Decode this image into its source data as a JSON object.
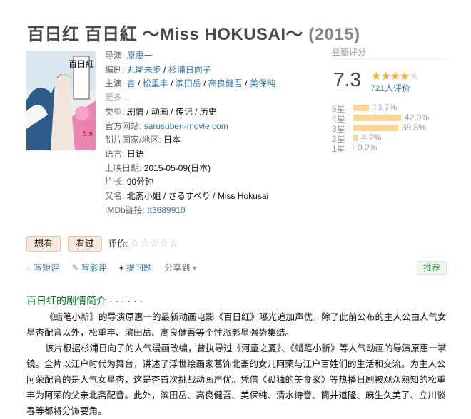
{
  "movie": {
    "title": "百日红 百日紅 ～Miss HOKUSAI～",
    "year": "(2015)"
  },
  "info": {
    "director": {
      "label": "导演",
      "values": [
        "原惠一"
      ]
    },
    "writers": {
      "label": "编剧",
      "values": [
        "丸尾未步",
        "杉浦日向子"
      ]
    },
    "cast": {
      "label": "主演",
      "values": [
        "杏",
        "松重丰",
        "滨田岳",
        "高良健吾",
        "美保纯"
      ],
      "more": "更多..."
    },
    "genre": {
      "label": "类型",
      "values": [
        "剧情",
        "动画",
        "传记",
        "历史"
      ]
    },
    "site": {
      "label": "官方网站",
      "value": "sarusuberi-movie.com"
    },
    "country": {
      "label": "制片国家/地区",
      "value": "日本"
    },
    "language": {
      "label": "语言",
      "value": "日语"
    },
    "release": {
      "label": "上映日期",
      "value": "2015-05-09(日本)"
    },
    "runtime": {
      "label": "片长",
      "value": "90分钟"
    },
    "aka": {
      "label": "又名",
      "value": "北斋小姐 / さるすべり / Miss Hokusai"
    },
    "imdb": {
      "label": "IMDb链接",
      "value": "tt3689910"
    }
  },
  "rating": {
    "header": "豆瓣评分",
    "score": "7.3",
    "stars_value": 3.5,
    "votes": "721人评价",
    "distribution": [
      {
        "label": "5星",
        "percent": 13.7,
        "text": "13.7%"
      },
      {
        "label": "4星",
        "percent": 42.0,
        "text": "42.0%"
      },
      {
        "label": "3星",
        "percent": 39.8,
        "text": "39.8%"
      },
      {
        "label": "2星",
        "percent": 4.2,
        "text": "4.2%"
      },
      {
        "label": "1星",
        "percent": 0.2,
        "text": "0.2%"
      }
    ]
  },
  "interest": {
    "want": "想看",
    "seen": "看过",
    "rate_label": "评价:"
  },
  "actions": {
    "short_review": "写短评",
    "review": "写影评",
    "ask": "提问题",
    "share": "分享到",
    "recommend": "推荐"
  },
  "summary": {
    "title": "百日红的剧情简介 · · · · · ·",
    "p1": "《蜡笔小新》的导演原惠一的最新动画电影《百日红》曝光追加声优，除了此前公布的主人公由人气女星杏配音以外，松重丰、滨田岳、高良健吾等个性派影星强势集结。",
    "p2": "该片根据杉浦日向子的人气漫画改编，曾执导过《河童之夏》、《蜡笔小新》等人气动画的导演原惠一掌镜。全片以江户时代为舞台，讲述了浮世绘画家葛饰北斋的女儿阿荣与江户百姓们的生活和交流。为主人公阿荣配音的是人气女星杏，这是杏首次挑战动画声优。凭借《孤独的美食家》等热播日剧被观众熟知的松重丰为阿荣的父亲北斋配音。此外，滨田岳、高良健吾、美保纯、清水诗音、筒井道隆、麻生久美子、立川谈春等都将分饰要角。"
  },
  "poster": {
    "caption_text": "百日紅",
    "date_text": "5.9"
  }
}
